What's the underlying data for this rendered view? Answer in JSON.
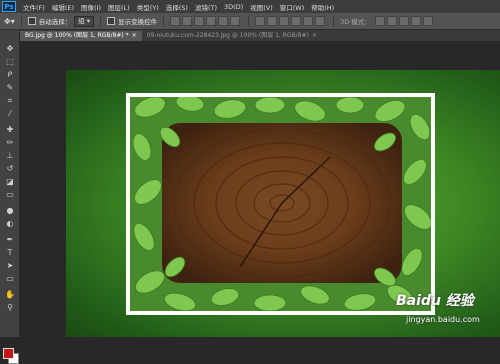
{
  "app": {
    "logo": "Ps"
  },
  "menubar": {
    "items": [
      "文件(F)",
      "编辑(E)",
      "图像(I)",
      "图层(L)",
      "类型(Y)",
      "选择(S)",
      "滤镜(T)",
      "3D(D)",
      "视图(V)",
      "窗口(W)",
      "帮助(H)"
    ]
  },
  "options_bar": {
    "auto_select_label": "自动选择：",
    "auto_select_value": "组",
    "show_transform_label": "显示变换控件",
    "mode_3d_label": "3D 模式："
  },
  "tabs": [
    {
      "label": "BG.jpg @ 100% (图层 1, RGB/8#) *",
      "close": "×"
    },
    {
      "label": "09-niutuku.com-228423.jpg @ 100% (图层 1, RGB/8#)",
      "close": "×"
    }
  ],
  "tools": [
    "move-tool",
    "marquee-tool",
    "lasso-tool",
    "quick-select-tool",
    "crop-tool",
    "eyedropper-tool",
    "healing-tool",
    "brush-tool",
    "stamp-tool",
    "history-brush-tool",
    "eraser-tool",
    "gradient-tool",
    "blur-tool",
    "dodge-tool",
    "pen-tool",
    "type-tool",
    "path-select-tool",
    "shape-tool",
    "hand-tool",
    "zoom-tool"
  ],
  "colors": {
    "foreground": "#c21818",
    "background": "#ffffff",
    "canvas_green": "#3f8a24",
    "frame": "#ffffff"
  },
  "watermark": {
    "logo": "Baidu 经验",
    "site": "jingyan.baidu.com"
  }
}
